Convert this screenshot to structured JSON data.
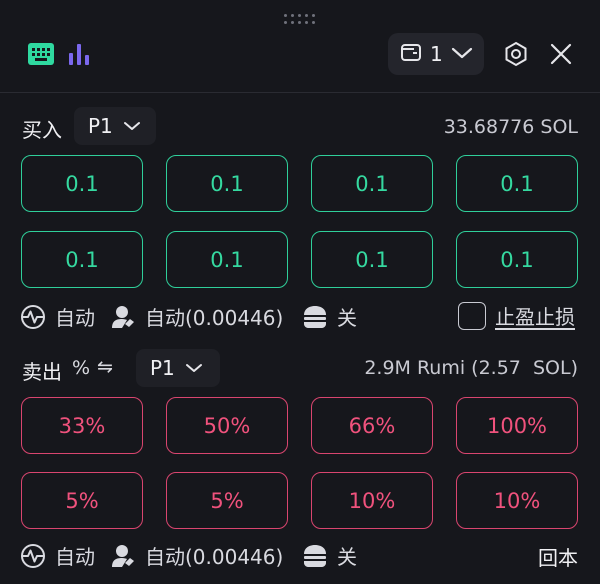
{
  "header": {
    "wallet_count": "1",
    "icons": [
      "keyboard-icon",
      "bar-chart-icon",
      "wallet-icon",
      "chevron-down-icon",
      "settings-icon",
      "close-icon"
    ],
    "accent_color": "#2fd9a0",
    "chart_icon_color": "#7b68ee"
  },
  "buy": {
    "label": "买入",
    "preset": "P1",
    "balance": "33.68776 SOL",
    "amounts": [
      "0.1",
      "0.1",
      "0.1",
      "0.1",
      "0.1",
      "0.1",
      "0.1",
      "0.1"
    ],
    "options": {
      "speed": "自动",
      "fee": "自动(0.00446)",
      "mev": "关",
      "tp_sl_label": "止盈止损",
      "tp_sl_checked": false
    },
    "color": "#2fcf9a"
  },
  "sell": {
    "label": "卖出",
    "percent_symbol": "%",
    "swap_symbol": "⇋",
    "preset": "P1",
    "holding": "2.9M Rumi (2.57  SOL)",
    "amounts": [
      "33%",
      "50%",
      "66%",
      "100%",
      "5%",
      "5%",
      "10%",
      "10%"
    ],
    "options": {
      "speed": "自动",
      "fee": "自动(0.00446)",
      "mev": "关",
      "breakeven_label": "回本"
    },
    "color": "#d9456f"
  }
}
